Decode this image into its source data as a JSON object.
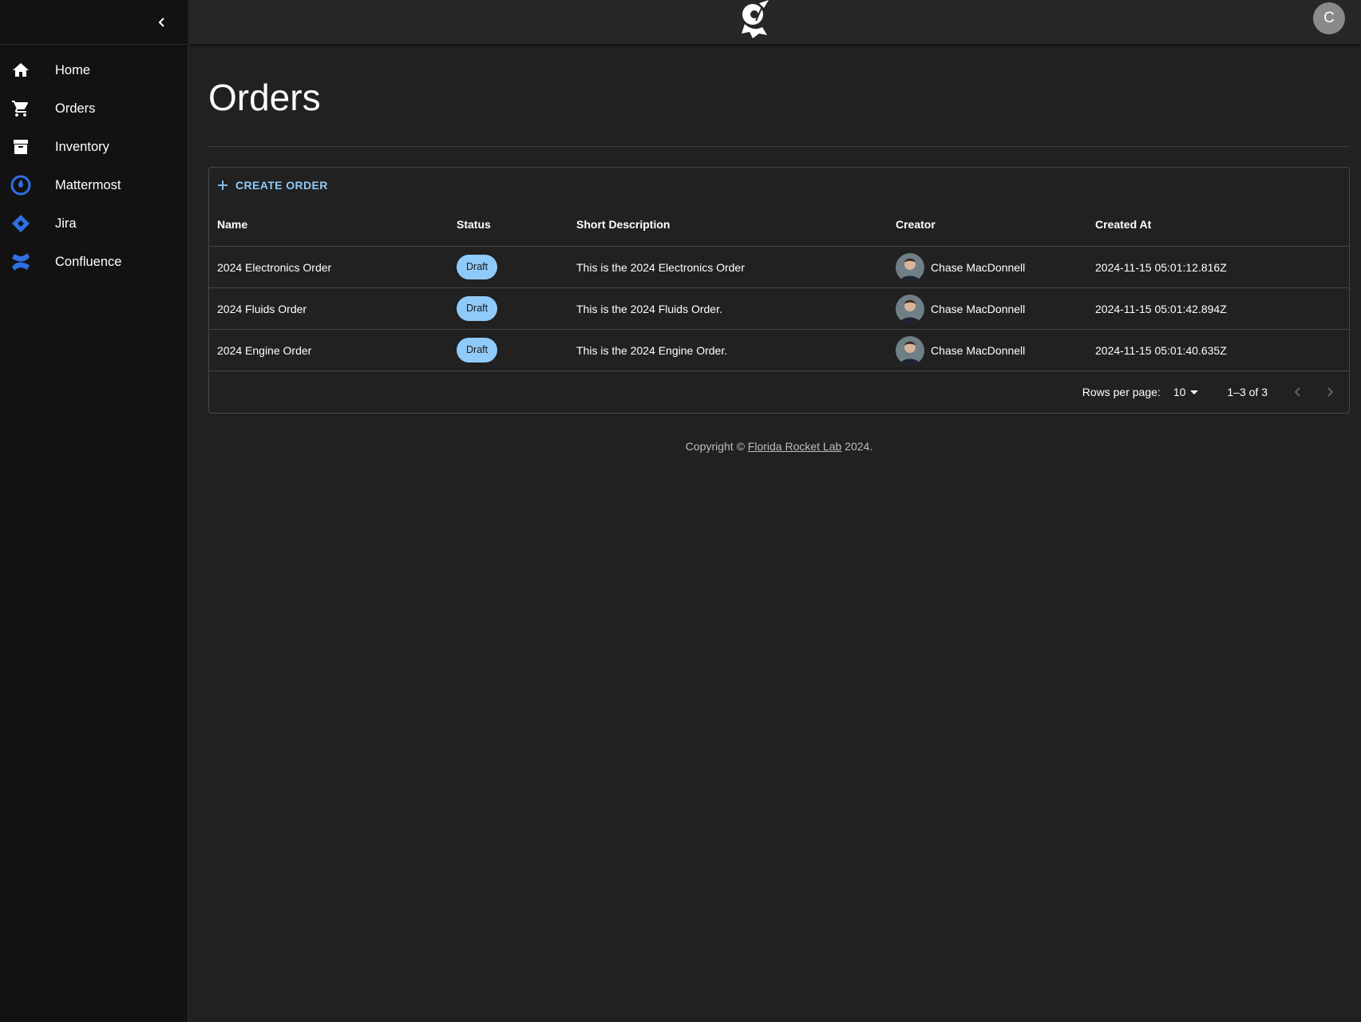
{
  "sidebar": {
    "items": [
      {
        "label": "Home",
        "icon": "home-icon"
      },
      {
        "label": "Orders",
        "icon": "cart-icon"
      },
      {
        "label": "Inventory",
        "icon": "archive-icon"
      },
      {
        "label": "Mattermost",
        "icon": "mattermost-icon"
      },
      {
        "label": "Jira",
        "icon": "jira-icon"
      },
      {
        "label": "Confluence",
        "icon": "confluence-icon"
      }
    ]
  },
  "topbar": {
    "avatar_letter": "C"
  },
  "page": {
    "title": "Orders"
  },
  "grid": {
    "create_label": "CREATE ORDER",
    "columns": [
      "Name",
      "Status",
      "Short Description",
      "Creator",
      "Created At"
    ],
    "rows": [
      {
        "name": "2024 Electronics Order",
        "status": "Draft",
        "description": "This is the 2024 Electronics Order",
        "creator": "Chase MacDonnell",
        "created_at": "2024-11-15 05:01:12.816Z"
      },
      {
        "name": "2024 Fluids Order",
        "status": "Draft",
        "description": "This is the 2024 Fluids Order.",
        "creator": "Chase MacDonnell",
        "created_at": "2024-11-15 05:01:42.894Z"
      },
      {
        "name": "2024 Engine Order",
        "status": "Draft",
        "description": "This is the 2024 Engine Order.",
        "creator": "Chase MacDonnell",
        "created_at": "2024-11-15 05:01:40.635Z"
      }
    ],
    "pagination": {
      "rows_per_page_label": "Rows per page:",
      "rows_per_page_value": "10",
      "range": "1–3 of 3"
    }
  },
  "footer": {
    "prefix": "Copyright © ",
    "link": "Florida Rocket Lab",
    "suffix": " 2024."
  },
  "colors": {
    "accent": "#90caf9",
    "sidebar_bg": "#121212",
    "content_bg": "#212121",
    "brand_blue": "#2f6fe4"
  }
}
